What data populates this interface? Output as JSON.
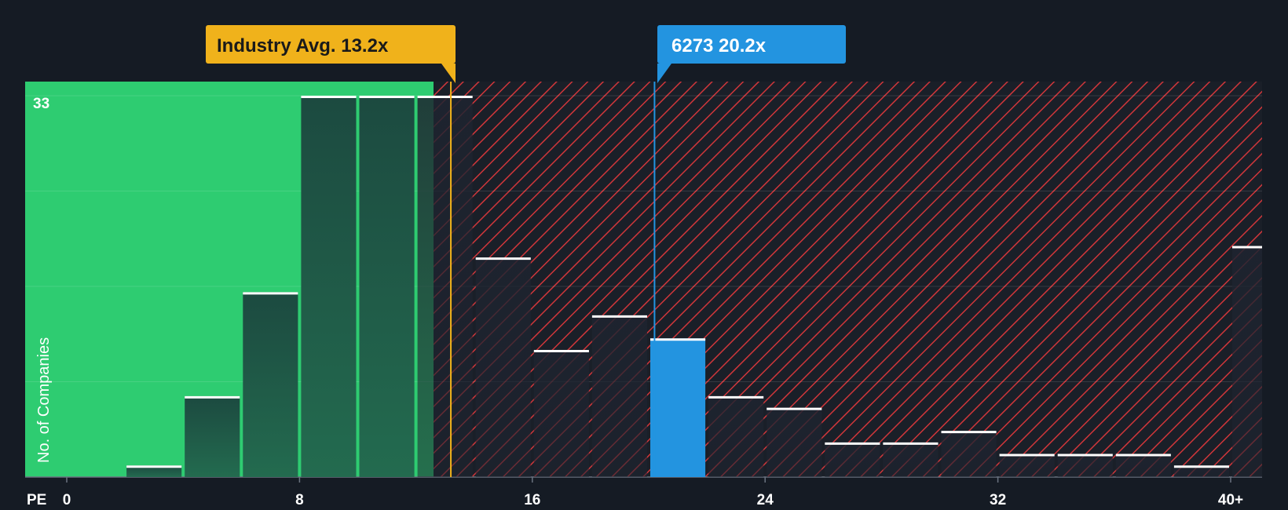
{
  "chart_data": {
    "type": "bar",
    "xlabel": "PE",
    "ylabel": "No. of Companies",
    "x_ticks": [
      "0",
      "8",
      "16",
      "24",
      "32",
      "40+"
    ],
    "y_max_label": "33",
    "bins": [
      {
        "start": 0,
        "end": 2,
        "count": 0
      },
      {
        "start": 2,
        "end": 4,
        "count": 1
      },
      {
        "start": 4,
        "end": 6,
        "count": 7
      },
      {
        "start": 6,
        "end": 8,
        "count": 16
      },
      {
        "start": 8,
        "end": 10,
        "count": 33
      },
      {
        "start": 10,
        "end": 12,
        "count": 33
      },
      {
        "start": 12,
        "end": 14,
        "count": 33
      },
      {
        "start": 14,
        "end": 16,
        "count": 19
      },
      {
        "start": 16,
        "end": 18,
        "count": 11
      },
      {
        "start": 18,
        "end": 20,
        "count": 14
      },
      {
        "start": 20,
        "end": 22,
        "count": 12
      },
      {
        "start": 22,
        "end": 24,
        "count": 7
      },
      {
        "start": 24,
        "end": 26,
        "count": 6
      },
      {
        "start": 26,
        "end": 28,
        "count": 3
      },
      {
        "start": 28,
        "end": 30,
        "count": 3
      },
      {
        "start": 30,
        "end": 32,
        "count": 4
      },
      {
        "start": 32,
        "end": 34,
        "count": 2
      },
      {
        "start": 34,
        "end": 36,
        "count": 2
      },
      {
        "start": 36,
        "end": 38,
        "count": 2
      },
      {
        "start": 38,
        "end": 40,
        "count": 1
      },
      {
        "start": 40,
        "end": 42,
        "count": 20
      }
    ],
    "x_range": [
      0,
      42
    ],
    "y_range": [
      0,
      34
    ],
    "industry_avg": {
      "label": "Industry Avg. 13.2x",
      "value": 13.2
    },
    "company": {
      "label": "6273 20.2x",
      "value": 20.2,
      "bin_index": 10
    },
    "colors": {
      "background": "#151b24",
      "fair_zone": "#2ecc71",
      "bar_dark": "#1f4a3f",
      "bar_in_red": "#1f2630",
      "red_hatch": "#d0363a",
      "company_bar": "#2394e0",
      "industry_callout": "#f0b21b",
      "company_callout": "#2394e0",
      "cap_line": "#ffffff",
      "text": "#ffffff"
    },
    "grid": true
  }
}
